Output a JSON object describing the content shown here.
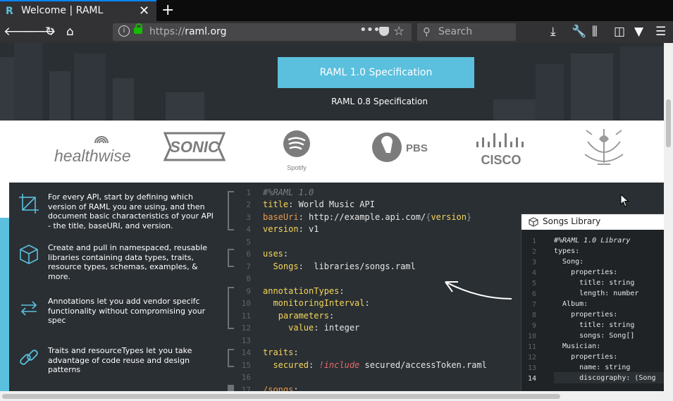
{
  "browser": {
    "tab_title": "Welcome | RAML",
    "url_prefix": "https://",
    "url_domain": "raml.org",
    "search_placeholder": "Search"
  },
  "hero": {
    "primary_button": "RAML 1.0 Specification",
    "secondary_link": "RAML 0.8 Specification"
  },
  "logos": {
    "healthwise": "healthwise",
    "sonic": "SONIC",
    "spotify": "Spotify",
    "pbs": "PBS",
    "cisco": "CISCO"
  },
  "features": [
    {
      "text": "For every API, start by defining which version of RAML you are using, and then document basic characteristics of your API - the title, baseURI, and version."
    },
    {
      "text": "Create and pull in namespaced, reusable libraries containing data types, traits, resource types, schemas, examples, & more."
    },
    {
      "text": "Annotations let you add vendor specifc functionality without compromising your spec"
    },
    {
      "text": "Traits and resourceTypes let you take advantage of code reuse and design patterns"
    }
  ],
  "code": {
    "line_numbers": [
      "1",
      "2",
      "3",
      "4",
      "5",
      "6",
      "7",
      "8",
      "9",
      "10",
      "11",
      "12",
      "13",
      "14",
      "15",
      "16",
      "17"
    ],
    "l1": "#%RAML 1.0",
    "l2_key": "title",
    "l2_val": " World Music API",
    "l3_key": "baseUri",
    "l3_val": " http://example.api.com/",
    "l3_brace_open": "{",
    "l3_var": "version",
    "l3_brace_close": "}",
    "l4_key": "version",
    "l4_val": " v1",
    "l6_key": "uses",
    "l7_key": "Songs",
    "l7_val": "  libraries/songs.raml",
    "l9_key": "annotationTypes",
    "l10_key": "monitoringInterval",
    "l11_key": "parameters",
    "l12_key": "value",
    "l12_val": " integer",
    "l14_key": "traits",
    "l15_key": "secured",
    "l15_inc": "!include",
    "l15_val": " secured/accessToken.raml",
    "l17_key": "/songs"
  },
  "songs_library": {
    "title": "Songs Library",
    "line_numbers": [
      "1",
      "2",
      "3",
      "4",
      "5",
      "6",
      "7",
      "8",
      "9",
      "10",
      "11",
      "12",
      "13",
      "14"
    ],
    "lines": [
      "#%RAML 1.0 Library",
      "types:",
      "  Song:",
      "    properties:",
      "      title: string",
      "      length: number",
      "  Album:",
      "    properties:",
      "      title: string",
      "      songs: Song[]",
      "  Musician:",
      "    properties:",
      "      name: string",
      "      discography: (Song"
    ]
  }
}
